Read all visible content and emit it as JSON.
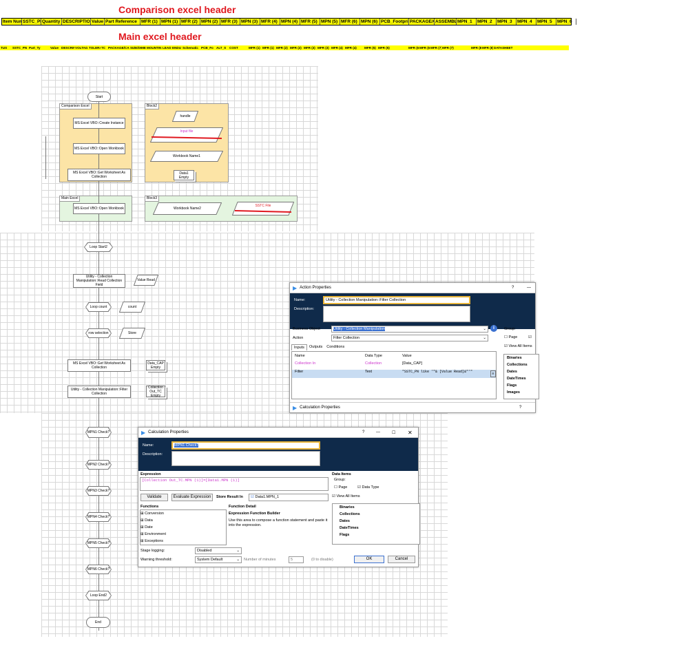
{
  "comparison": {
    "title": "Comparison excel header",
    "headers": [
      "Item Num",
      "SSTC_PN",
      "Quantity",
      "DESCRIPTION",
      "Value",
      "Part Reference",
      "MFR (1)",
      "MPN (1)",
      "MFR (2)",
      "MPN (2)",
      "MFR (3)",
      "MPN (3)",
      "MFR (4)",
      "MPN (4)",
      "MFR (5)",
      "MPN (5)",
      "MFR (6)",
      "MPN (6)",
      "PCB_Footprint",
      "PACKAGE/CA",
      "ASSEMBLY",
      "MPN_1",
      "MPN_2",
      "MPN_3",
      "MPN_4",
      "MPN_5",
      "MPN_6"
    ]
  },
  "main": {
    "title": "Main excel header",
    "headers": [
      "TUS",
      "SSTC_PN",
      "Part_Ty",
      "Value",
      "DESCRIPT",
      "VOLTAG",
      "TOLERA",
      "TC",
      "PACKAGE/CASE",
      "SIZE/DIMEN",
      "MOUNTIN",
      "LEAD",
      "ENDU",
      "Schematic",
      "PCB_Fo",
      "ALT_S",
      "COST",
      "MFR (1)",
      "MFR (1)",
      "MFR (2)",
      "MFR (2)",
      "MFR (3)",
      "MFR (3)",
      "MFR (4)",
      "MFR (4)",
      "MFR (5)",
      "MFR (5)",
      "MFR (6)",
      "MFR (6)",
      "MFR (7)",
      "MFR (7)",
      "MFR (8)",
      "MFR (8)",
      "DATASHEET"
    ]
  },
  "flow": {
    "start": "Start",
    "block_comparison": "Comparison Excel",
    "block2": "Block2",
    "create_instance": "MS Excel VBO::Create Instance",
    "open_workbook": "MS Excel VBO::Open Workbook",
    "get_worksheet": "MS Excel VBO::Get Worksheet As Collection",
    "handle": "handle",
    "input_file": "Input file",
    "workbook_name1": "Workbook Name1",
    "data1": "Data1",
    "data1_sub": "Empty",
    "block_main": "Main Excel",
    "block3": "Block3",
    "main_open_workbook": "MS Excel VBO::Open Workbook",
    "workbook_name2": "Workbook Name2",
    "sstc_file": "SSTC File",
    "loop_start": "Loop Start2",
    "read_collection_field": "Utility - Collection Manipulation::Read Collection Field",
    "value_read": "Value Read",
    "loop_count": "Loop count",
    "count": "count",
    "row_selection": "row selection",
    "store": "Store",
    "get_worksheet2": "MS Excel VBO::Get Worksheet As Collection",
    "data_cap": "Data_CAP",
    "data_cap_sub": "Empty",
    "filter_collection": "Utility - Collection Manipulation::Filter Collection",
    "collection_out": "Collection Out_TC",
    "collection_out_sub": "Empty",
    "mpn1": "MPN1 Check?",
    "mpn2": "MPN2 Check?",
    "mpn3": "MPN3 Check?",
    "mpn4": "MPN4 Check?",
    "mpn5": "MPN5 Check?",
    "mpn6": "MPN6 Check?",
    "loop_end": "Loop End2",
    "end": "End"
  },
  "action_props": {
    "title": "Action Properties",
    "help": "?",
    "name_label": "Name:",
    "name_value": "Utility - Collection Manipulation::Filter Collection",
    "desc_label": "Description:",
    "bo_label": "Business Object",
    "bo_value": "Utility - Collection Manipulation",
    "action_label": "Action",
    "action_value": "Filter Collection",
    "tabs": [
      "Inputs",
      "Outputs",
      "Conditions"
    ],
    "cols": [
      "Name",
      "Data Type",
      "Value"
    ],
    "rows": [
      {
        "name": "Collection In",
        "type": "Collection",
        "value": "[Data_CAP]"
      },
      {
        "name": "Filter",
        "type": "Text",
        "value": "\"SSTC_PN like '\"& [Value Read]&\"'\""
      }
    ],
    "group_label": "Group:",
    "page_label": "Page",
    "view_all": "View All Items",
    "tree": [
      "Binaries",
      "Collections",
      "Dates",
      "DateTimes",
      "Flags",
      "Images"
    ],
    "calc_bar": "Calculation Properties"
  },
  "calc_props": {
    "title": "Calculation Properties",
    "help": "?",
    "name_label": "Name:",
    "name_value": "MPN1 Check?",
    "desc_label": "Description:",
    "expr_label": "Expression",
    "expression": "[Collection Out_TC.MPN (1)]=[Data1.MPN (1)]",
    "validate": "Validate",
    "evaluate": "Evaluate Expression",
    "store_label": "Store Result In",
    "store_value": "Data1.MPN_1",
    "functions_label": "Functions",
    "functions": [
      "Conversion",
      "Data",
      "Date",
      "Environment",
      "Exceptions"
    ],
    "detail_label": "Function Detail",
    "detail_title": "Expression Function Builder",
    "detail_text": "Use this area to compose a function statement and paste it into the expression.",
    "data_items": "Data Items",
    "group_label": "Group:",
    "page_label": "Page",
    "datatype_label": "Data Type",
    "view_all": "View All Items",
    "tree": [
      "Binaries",
      "Collections",
      "Dates",
      "DateTimes",
      "Flags"
    ],
    "stage_logging_label": "Stage logging:",
    "stage_logging": "Disabled",
    "warning_label": "Warning threshold:",
    "warning_value": "System Default",
    "minutes_label": "Number of minutes",
    "minutes_value": "5",
    "disable_note": "(0 to disable)",
    "ok": "OK",
    "cancel": "Cancel"
  },
  "colors": {
    "title_red": "#e0181f",
    "header_yellow": "#ffff00",
    "block_orange": "#fce4a6",
    "block_green": "#e4f5e0",
    "navy": "#0f2a4a",
    "magenta": "#cc33cc"
  }
}
